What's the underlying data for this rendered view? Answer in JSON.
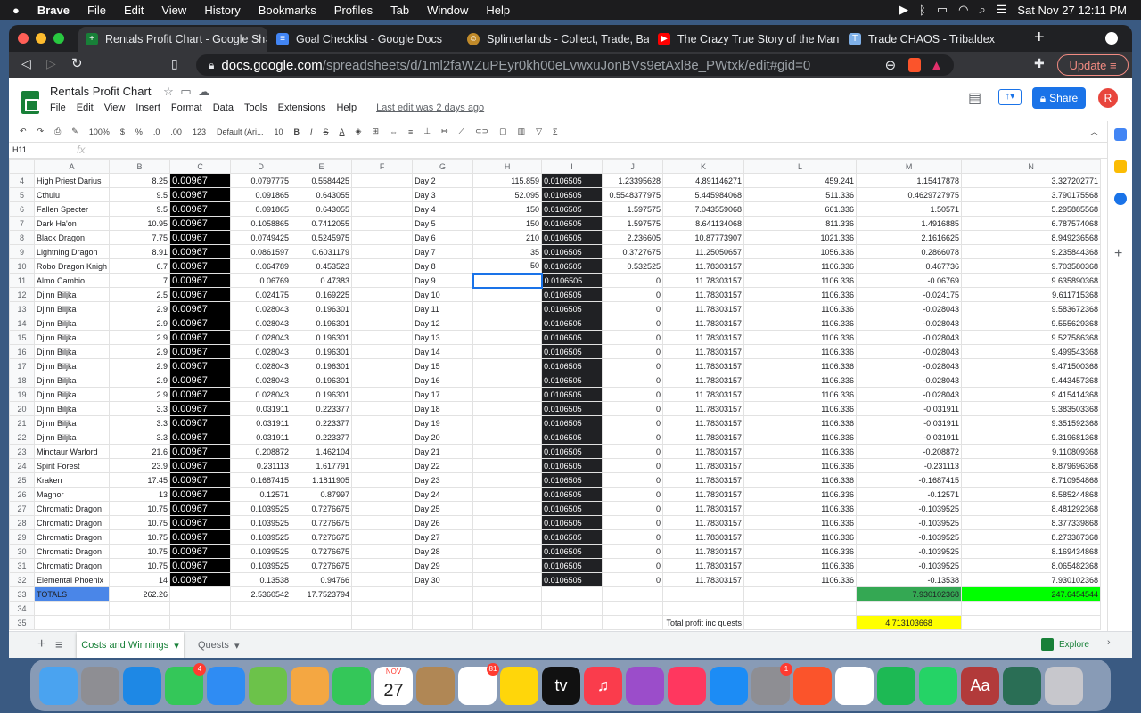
{
  "mac_menu": {
    "apple": "",
    "app": "Brave",
    "items": [
      "File",
      "Edit",
      "View",
      "History",
      "Bookmarks",
      "Profiles",
      "Tab",
      "Window",
      "Help"
    ],
    "datetime": "Sat Nov 27  12:11 PM"
  },
  "browser": {
    "tabs": [
      {
        "title": "Rentals Profit Chart - Google Sh",
        "icon": "sheets-icon",
        "color": "#188038"
      },
      {
        "title": "Goal Checklist - Google Docs",
        "icon": "docs-icon",
        "color": "#4285f4"
      },
      {
        "title": "Splinterlands - Collect, Trade, Battle",
        "icon": "splinterlands-icon",
        "color": "#c08a2a"
      },
      {
        "title": "The Crazy True Story of the Man Wh",
        "icon": "youtube-icon",
        "color": "#ff0000"
      },
      {
        "title": "Trade CHAOS - Tribaldex",
        "icon": "tribaldex-icon",
        "color": "#7fb0e8"
      }
    ],
    "url_host": "docs.google.com",
    "url_path": "/spreadsheets/d/1ml2faWZuPEyr0kh00eLvwxuJonBVs9etAxl8e_PWtxk/edit#gid=0",
    "update_label": "Update"
  },
  "doc": {
    "title": "Rentals Profit Chart",
    "menus": [
      "File",
      "Edit",
      "View",
      "Insert",
      "Format",
      "Data",
      "Tools",
      "Extensions",
      "Help"
    ],
    "last_edit": "Last edit was 2 days ago",
    "share_label": "Share",
    "avatar": "R"
  },
  "toolbar": {
    "zoom": "100%",
    "currency": "$",
    "percent": "%",
    "dec_less": ".0",
    "dec_more": ".00",
    "format": "123",
    "font": "Default (Ari...",
    "size": "10",
    "bold": "B",
    "italic": "I",
    "strike": "S",
    "textcolor": "A"
  },
  "formula": {
    "cell": "H11",
    "fx": "fx"
  },
  "columns": [
    "",
    "A",
    "B",
    "C",
    "D",
    "E",
    "F",
    "G",
    "H",
    "I",
    "J",
    "K",
    "L",
    "M",
    "N"
  ],
  "rows": [
    [
      "4",
      "High Priest Darius",
      "8.25",
      "0.00967",
      "0.0797775",
      "0.5584425",
      "",
      "Day 2",
      "115.859",
      "0.0106505",
      "1.23395628",
      "4.891146271",
      "459.241",
      "1.15417878",
      "3.327202771"
    ],
    [
      "5",
      "Cthulu",
      "9.5",
      "0.00967",
      "0.091865",
      "0.643055",
      "",
      "Day 3",
      "52.095",
      "0.0106505",
      "0.5548377975",
      "5.445984068",
      "511.336",
      "0.4629727975",
      "3.790175568"
    ],
    [
      "6",
      "Fallen Specter",
      "9.5",
      "0.00967",
      "0.091865",
      "0.643055",
      "",
      "Day 4",
      "150",
      "0.0106505",
      "1.597575",
      "7.043559068",
      "661.336",
      "1.50571",
      "5.295885568"
    ],
    [
      "7",
      "Dark Ha'on",
      "10.95",
      "0.00967",
      "0.1058865",
      "0.7412055",
      "",
      "Day 5",
      "150",
      "0.0106505",
      "1.597575",
      "8.641134068",
      "811.336",
      "1.4916885",
      "6.787574068"
    ],
    [
      "8",
      "Black Dragon",
      "7.75",
      "0.00967",
      "0.0749425",
      "0.5245975",
      "",
      "Day 6",
      "210",
      "0.0106505",
      "2.236605",
      "10.87773907",
      "1021.336",
      "2.1616625",
      "8.949236568"
    ],
    [
      "9",
      "Lightning Dragon",
      "8.91",
      "0.00967",
      "0.0861597",
      "0.6031179",
      "",
      "Day 7",
      "35",
      "0.0106505",
      "0.3727675",
      "11.25050657",
      "1056.336",
      "0.2866078",
      "9.235844368"
    ],
    [
      "10",
      "Robo Dragon Knigh",
      "6.7",
      "0.00967",
      "0.064789",
      "0.453523",
      "",
      "Day 8",
      "50",
      "0.0106505",
      "0.532525",
      "11.78303157",
      "1106.336",
      "0.467736",
      "9.703580368"
    ],
    [
      "11",
      "Almo Cambio",
      "7",
      "0.00967",
      "0.06769",
      "0.47383",
      "",
      "Day 9",
      "",
      "0.0106505",
      "0",
      "11.78303157",
      "1106.336",
      "-0.06769",
      "9.635890368"
    ],
    [
      "12",
      "Djinn Biljka",
      "2.5",
      "0.00967",
      "0.024175",
      "0.169225",
      "",
      "Day 10",
      "",
      "0.0106505",
      "0",
      "11.78303157",
      "1106.336",
      "-0.024175",
      "9.611715368"
    ],
    [
      "13",
      "Djinn Biljka",
      "2.9",
      "0.00967",
      "0.028043",
      "0.196301",
      "",
      "Day 11",
      "",
      "0.0106505",
      "0",
      "11.78303157",
      "1106.336",
      "-0.028043",
      "9.583672368"
    ],
    [
      "14",
      "Djinn Biljka",
      "2.9",
      "0.00967",
      "0.028043",
      "0.196301",
      "",
      "Day 12",
      "",
      "0.0106505",
      "0",
      "11.78303157",
      "1106.336",
      "-0.028043",
      "9.555629368"
    ],
    [
      "15",
      "Djinn Biljka",
      "2.9",
      "0.00967",
      "0.028043",
      "0.196301",
      "",
      "Day 13",
      "",
      "0.0106505",
      "0",
      "11.78303157",
      "1106.336",
      "-0.028043",
      "9.527586368"
    ],
    [
      "16",
      "Djinn Biljka",
      "2.9",
      "0.00967",
      "0.028043",
      "0.196301",
      "",
      "Day 14",
      "",
      "0.0106505",
      "0",
      "11.78303157",
      "1106.336",
      "-0.028043",
      "9.499543368"
    ],
    [
      "17",
      "Djinn Biljka",
      "2.9",
      "0.00967",
      "0.028043",
      "0.196301",
      "",
      "Day 15",
      "",
      "0.0106505",
      "0",
      "11.78303157",
      "1106.336",
      "-0.028043",
      "9.471500368"
    ],
    [
      "18",
      "Djinn Biljka",
      "2.9",
      "0.00967",
      "0.028043",
      "0.196301",
      "",
      "Day 16",
      "",
      "0.0106505",
      "0",
      "11.78303157",
      "1106.336",
      "-0.028043",
      "9.443457368"
    ],
    [
      "19",
      "Djinn Biljka",
      "2.9",
      "0.00967",
      "0.028043",
      "0.196301",
      "",
      "Day 17",
      "",
      "0.0106505",
      "0",
      "11.78303157",
      "1106.336",
      "-0.028043",
      "9.415414368"
    ],
    [
      "20",
      "Djinn Biljka",
      "3.3",
      "0.00967",
      "0.031911",
      "0.223377",
      "",
      "Day 18",
      "",
      "0.0106505",
      "0",
      "11.78303157",
      "1106.336",
      "-0.031911",
      "9.383503368"
    ],
    [
      "21",
      "Djinn Biljka",
      "3.3",
      "0.00967",
      "0.031911",
      "0.223377",
      "",
      "Day 19",
      "",
      "0.0106505",
      "0",
      "11.78303157",
      "1106.336",
      "-0.031911",
      "9.351592368"
    ],
    [
      "22",
      "Djinn Biljka",
      "3.3",
      "0.00967",
      "0.031911",
      "0.223377",
      "",
      "Day 20",
      "",
      "0.0106505",
      "0",
      "11.78303157",
      "1106.336",
      "-0.031911",
      "9.319681368"
    ],
    [
      "23",
      "Minotaur Warlord",
      "21.6",
      "0.00967",
      "0.208872",
      "1.462104",
      "",
      "Day 21",
      "",
      "0.0106505",
      "0",
      "11.78303157",
      "1106.336",
      "-0.208872",
      "9.110809368"
    ],
    [
      "24",
      "Spirit Forest",
      "23.9",
      "0.00967",
      "0.231113",
      "1.617791",
      "",
      "Day 22",
      "",
      "0.0106505",
      "0",
      "11.78303157",
      "1106.336",
      "-0.231113",
      "8.879696368"
    ],
    [
      "25",
      "Kraken",
      "17.45",
      "0.00967",
      "0.1687415",
      "1.1811905",
      "",
      "Day 23",
      "",
      "0.0106505",
      "0",
      "11.78303157",
      "1106.336",
      "-0.1687415",
      "8.710954868"
    ],
    [
      "26",
      "Magnor",
      "13",
      "0.00967",
      "0.12571",
      "0.87997",
      "",
      "Day 24",
      "",
      "0.0106505",
      "0",
      "11.78303157",
      "1106.336",
      "-0.12571",
      "8.585244868"
    ],
    [
      "27",
      "Chromatic Dragon",
      "10.75",
      "0.00967",
      "0.1039525",
      "0.7276675",
      "",
      "Day 25",
      "",
      "0.0106505",
      "0",
      "11.78303157",
      "1106.336",
      "-0.1039525",
      "8.481292368"
    ],
    [
      "28",
      "Chromatic Dragon",
      "10.75",
      "0.00967",
      "0.1039525",
      "0.7276675",
      "",
      "Day 26",
      "",
      "0.0106505",
      "0",
      "11.78303157",
      "1106.336",
      "-0.1039525",
      "8.377339868"
    ],
    [
      "29",
      "Chromatic Dragon",
      "10.75",
      "0.00967",
      "0.1039525",
      "0.7276675",
      "",
      "Day 27",
      "",
      "0.0106505",
      "0",
      "11.78303157",
      "1106.336",
      "-0.1039525",
      "8.273387368"
    ],
    [
      "30",
      "Chromatic Dragon",
      "10.75",
      "0.00967",
      "0.1039525",
      "0.7276675",
      "",
      "Day 28",
      "",
      "0.0106505",
      "0",
      "11.78303157",
      "1106.336",
      "-0.1039525",
      "8.169434868"
    ],
    [
      "31",
      "Chromatic Dragon",
      "10.75",
      "0.00967",
      "0.1039525",
      "0.7276675",
      "",
      "Day 29",
      "",
      "0.0106505",
      "0",
      "11.78303157",
      "1106.336",
      "-0.1039525",
      "8.065482368"
    ],
    [
      "32",
      "Elemental Phoenix",
      "14",
      "0.00967",
      "0.13538",
      "0.94766",
      "",
      "Day 30",
      "",
      "0.0106505",
      "0",
      "11.78303157",
      "1106.336",
      "-0.13538",
      "7.930102368"
    ],
    [
      "33",
      "TOTALS",
      "262.26",
      "",
      "2.5360542",
      "17.7523794",
      "",
      "",
      "",
      "",
      "",
      "",
      "",
      "7.930102368",
      "247.6454544"
    ],
    [
      "34",
      "",
      "",
      "",
      "",
      "",
      "",
      "",
      "",
      "",
      "",
      "",
      "",
      "",
      ""
    ],
    [
      "35",
      "",
      "",
      "",
      "",
      "",
      "",
      "",
      "",
      "",
      "",
      "Total profit inc quests",
      "",
      "4.713103668",
      ""
    ]
  ],
  "sheet_tabs": {
    "add": "+",
    "all": "≡",
    "active": "Costs and Winnings",
    "other": "Quests",
    "explore": "Explore"
  },
  "dock": [
    {
      "name": "finder-icon",
      "color": "#4aa3f0",
      "label": ""
    },
    {
      "name": "launchpad-icon",
      "color": "#8e8e93",
      "label": ""
    },
    {
      "name": "safari-icon",
      "color": "#1e88e5",
      "label": ""
    },
    {
      "name": "messages-icon",
      "color": "#34c759",
      "label": "",
      "badge": "4"
    },
    {
      "name": "mail-icon",
      "color": "#2f8cf3",
      "label": ""
    },
    {
      "name": "maps-icon",
      "color": "#6cc24a",
      "label": ""
    },
    {
      "name": "photos-icon",
      "color": "#f4a742",
      "label": ""
    },
    {
      "name": "facetime-icon",
      "color": "#34c759",
      "label": ""
    },
    {
      "name": "calendar-icon",
      "color": "#ffffff",
      "label": "27",
      "month": "NOV"
    },
    {
      "name": "contacts-icon",
      "color": "#b08755",
      "label": ""
    },
    {
      "name": "reminders-icon",
      "color": "#ffffff",
      "label": "",
      "badge": "81"
    },
    {
      "name": "notes-icon",
      "color": "#ffd60a",
      "label": ""
    },
    {
      "name": "appletv-icon",
      "color": "#111111",
      "label": "tv"
    },
    {
      "name": "music-icon",
      "color": "#fa3c4c",
      "label": "♫"
    },
    {
      "name": "podcasts-icon",
      "color": "#9b4dca",
      "label": ""
    },
    {
      "name": "news-icon",
      "color": "#ff375f",
      "label": ""
    },
    {
      "name": "appstore-icon",
      "color": "#1c8cf5",
      "label": ""
    },
    {
      "name": "system-preferences-icon",
      "color": "#8e8e93",
      "label": "",
      "badge": "1"
    },
    {
      "name": "brave-icon",
      "color": "#fb542b",
      "label": ""
    },
    {
      "name": "chrome-icon",
      "color": "#ffffff",
      "label": ""
    },
    {
      "name": "spotify-icon",
      "color": "#1db954",
      "label": ""
    },
    {
      "name": "whatsapp-icon",
      "color": "#25d366",
      "label": ""
    },
    {
      "name": "dictionary-icon",
      "color": "#b23a3a",
      "label": "Aa"
    },
    {
      "name": "screenshot-thumbnail-icon",
      "color": "#2a6e55",
      "label": ""
    },
    {
      "name": "trash-icon",
      "color": "#c7c7cc",
      "label": ""
    }
  ]
}
